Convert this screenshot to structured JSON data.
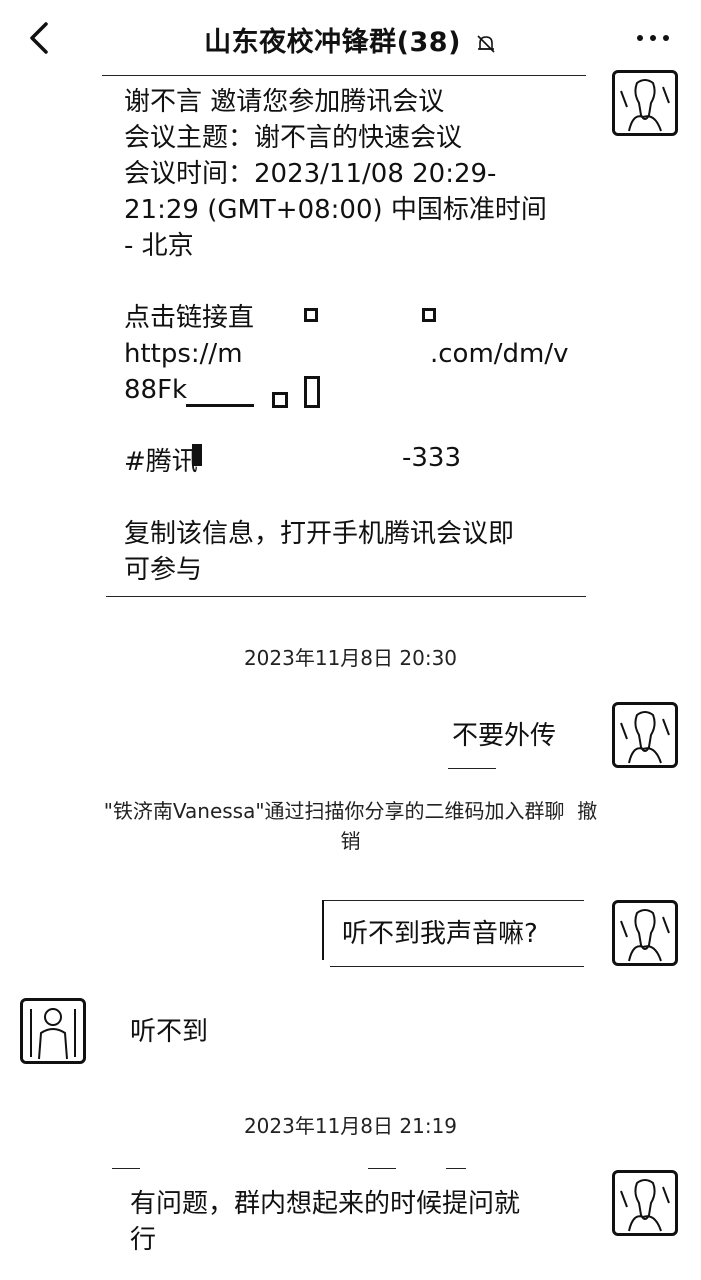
{
  "header": {
    "title": "山东夜校冲锋群(38)",
    "back_icon": "chevron-left-icon",
    "mute_icon": "bell-slash-icon",
    "more_icon": "more-dots-icon"
  },
  "messages": [
    {
      "text": "谢不言 邀请您参加腾讯会议\n会议主题：谢不言的快速会议\n会议时间：2023/11/08 20:29-\n21:29 (GMT+08:00) 中国标准时间\n- 北京\n\n点击链接直\nhttps://m\n88Fk\n\n#腾讯\n\n复制该信息，打开手机腾讯会议即\n可参与",
      "link_tail": ".com/dm/v",
      "code_tail": "-333"
    },
    {
      "text": "不要外传"
    },
    {
      "text": "听不到我声音嘛?"
    },
    {
      "text": "听不到"
    },
    {
      "text": "有问题，群内想起来的时候提问就\n行"
    }
  ],
  "timestamps": [
    "2023年11月8日 20:30",
    "2023年11月8日 21:19"
  ],
  "system_notice": "\"铁济南Vanessa\"通过扫描你分享的二维码加入群聊  撤\n销"
}
